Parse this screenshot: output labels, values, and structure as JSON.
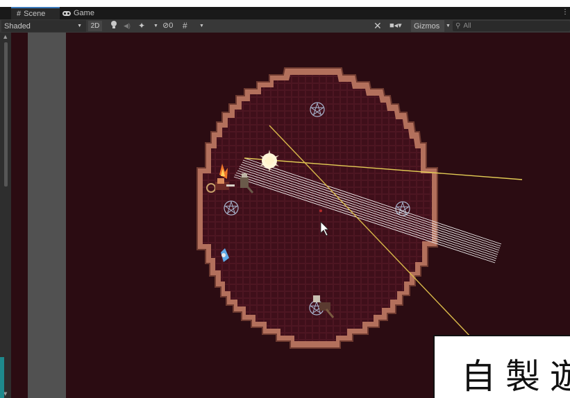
{
  "tabs": [
    {
      "label": "Scene",
      "icon": "grid-icon",
      "active": true
    },
    {
      "label": "Game",
      "icon": "gamepad-icon",
      "active": false
    }
  ],
  "toolbar": {
    "shading_mode": "Shaded",
    "mode_2d": "2D",
    "visibility_count": "0",
    "gizmos_label": "Gizmos",
    "search_placeholder": "All"
  },
  "caption": {
    "text": "自製遊"
  },
  "colors": {
    "scene_background": "#2b0c12",
    "arena_floor": "#3f0f1a",
    "wall_brick": "#b3705c",
    "laser_white": "#f2f2f2",
    "laser_yellow": "#e3cc55",
    "pentagram": "#a9b6cf"
  },
  "scene": {
    "pentagram_count": 4,
    "cursor": "arrow-cursor-icon"
  }
}
